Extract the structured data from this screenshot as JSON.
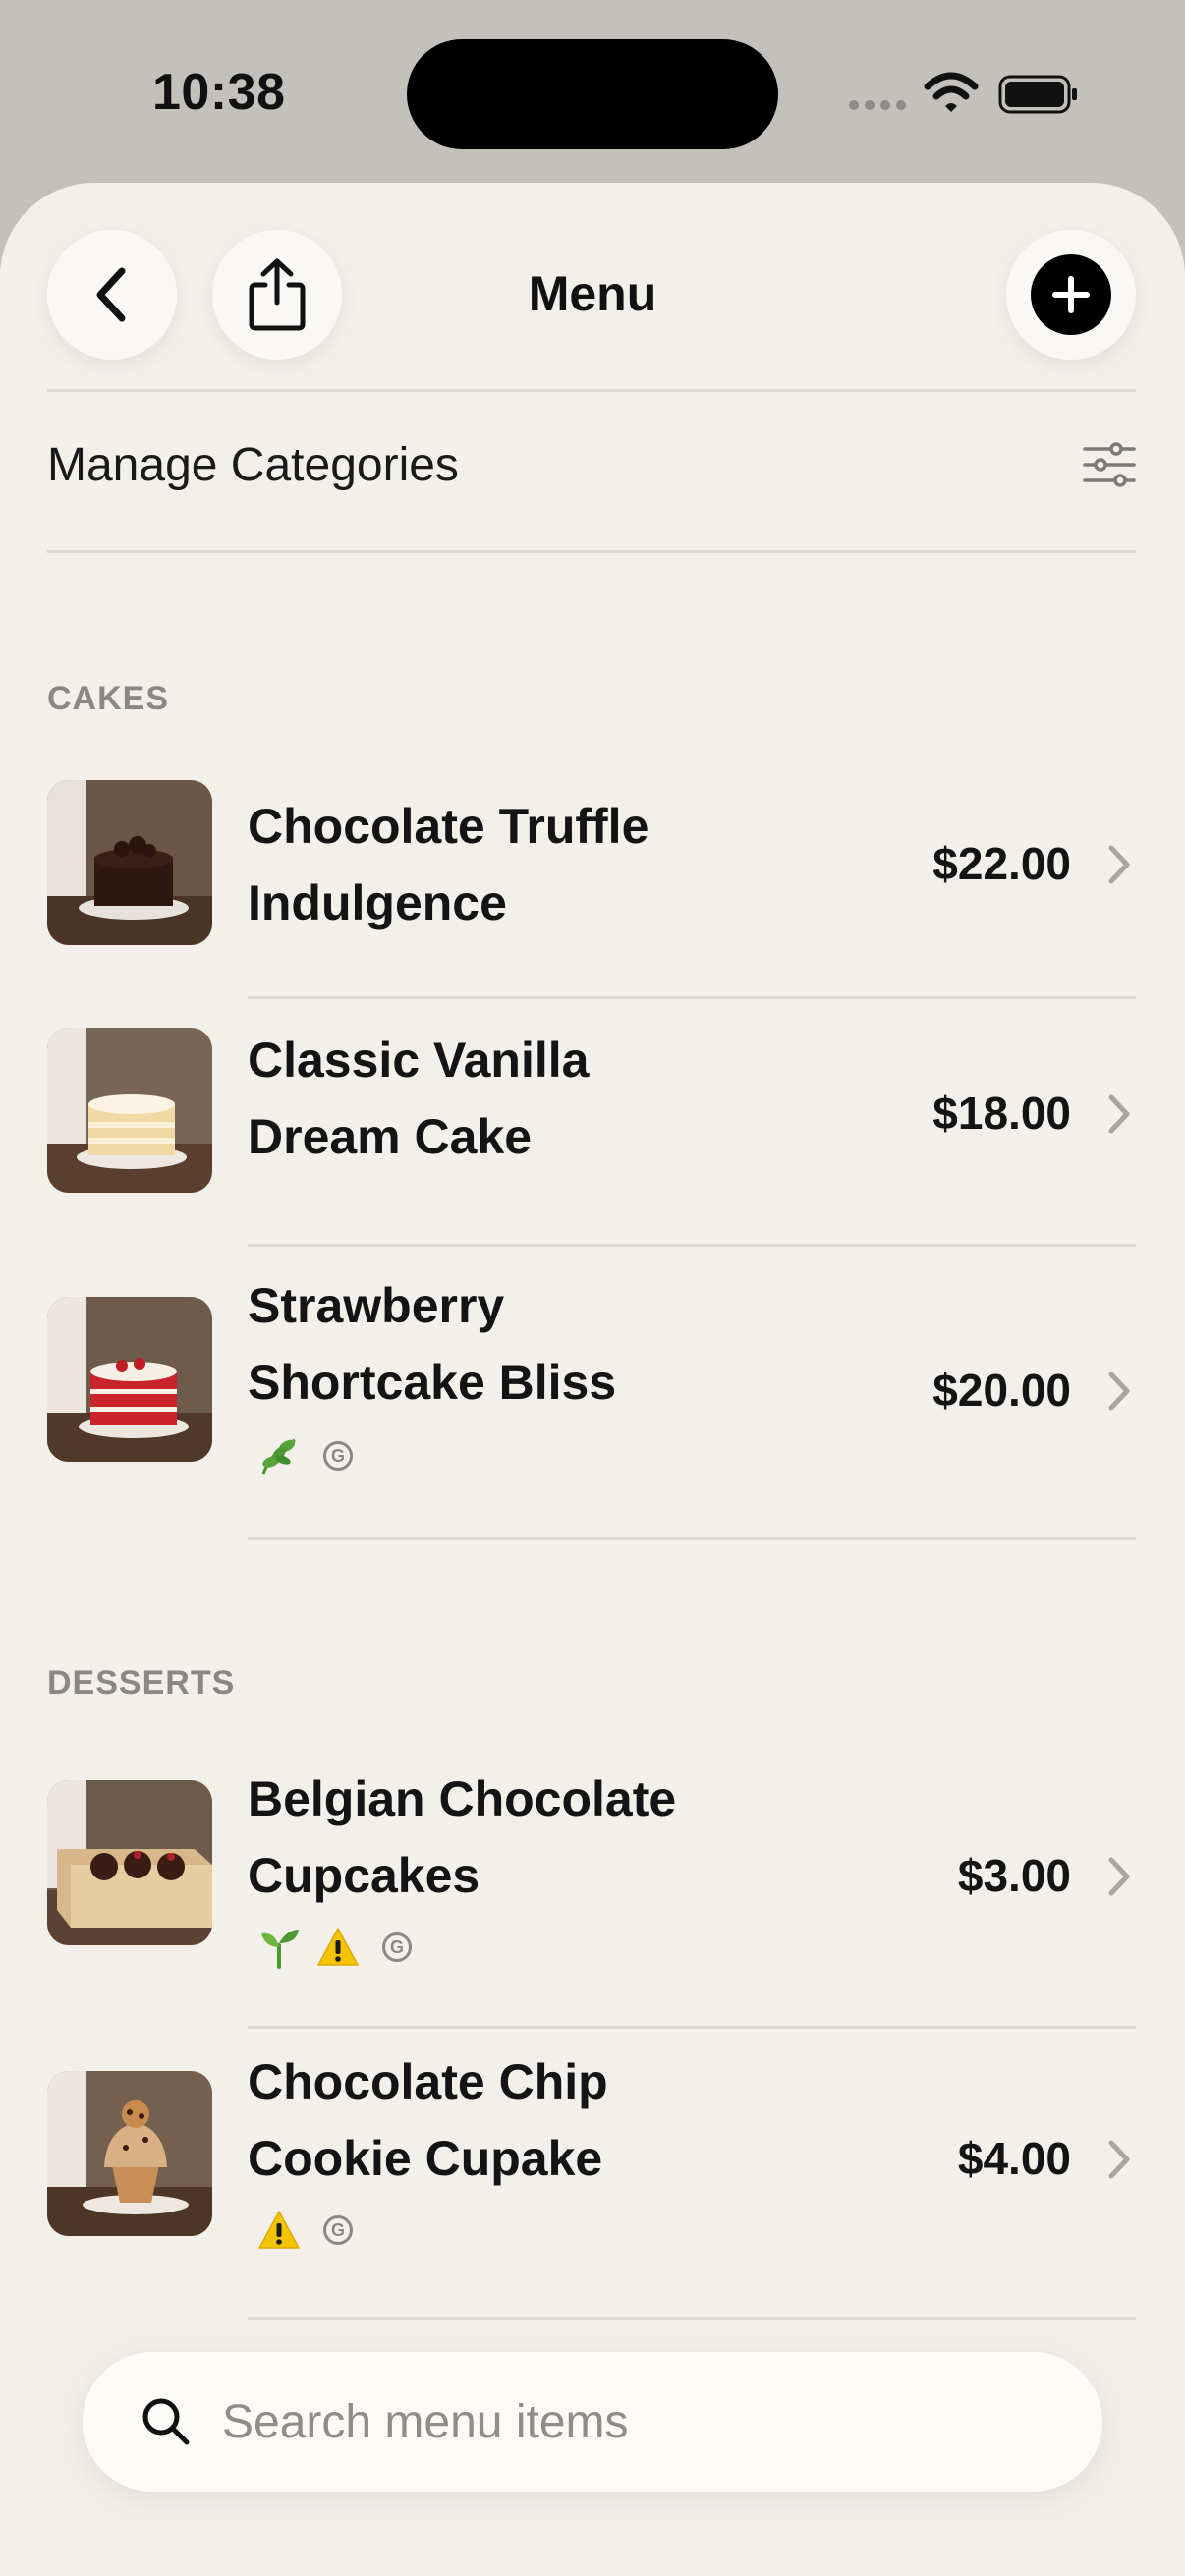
{
  "status_bar": {
    "time": "10:38"
  },
  "header": {
    "title": "Menu"
  },
  "manage": {
    "label": "Manage Categories"
  },
  "sections": [
    {
      "header": "CAKES",
      "items": [
        {
          "name_line1": "Chocolate Truffle",
          "name_line2": "Indulgence",
          "price": "$22.00",
          "tags": []
        },
        {
          "name_line1": "Classic Vanilla",
          "name_line2": "Dream Cake",
          "price": "$18.00",
          "tags": []
        },
        {
          "name_line1": "Strawberry",
          "name_line2": "Shortcake Bliss",
          "price": "$20.00",
          "tags": [
            "leaf-icon",
            "gmo-icon"
          ]
        }
      ]
    },
    {
      "header": "DESSERTS",
      "items": [
        {
          "name_line1": "Belgian Chocolate",
          "name_line2": "Cupcakes",
          "price": "$3.00",
          "tags": [
            "seedling-icon",
            "warning-icon",
            "gmo-icon"
          ]
        },
        {
          "name_line1": "Chocolate Chip",
          "name_line2": "Cookie Cupake",
          "price": "$4.00",
          "tags": [
            "warning-icon",
            "gmo-icon"
          ]
        }
      ]
    }
  ],
  "search": {
    "placeholder": "Search menu items"
  },
  "colors": {
    "background": "#f3f0ec",
    "accent": "#000000",
    "warning": "#f5c400",
    "leaf": "#3f8f2e"
  }
}
